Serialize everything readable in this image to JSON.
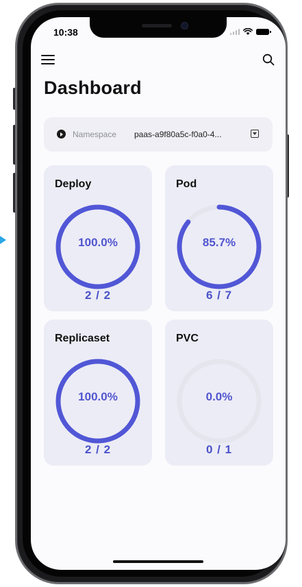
{
  "status_bar": {
    "time": "10:38"
  },
  "header": {
    "title": "Dashboard"
  },
  "namespace": {
    "label": "Namespace",
    "value": "paas-a9f80a5c-f0a0-4..."
  },
  "cards": [
    {
      "title": "Deploy",
      "percent_label": "100.0%",
      "count": "2 / 2",
      "ratio": 1.0
    },
    {
      "title": "Pod",
      "percent_label": "85.7%",
      "count": "6 / 7",
      "ratio": 0.857
    },
    {
      "title": "Replicaset",
      "percent_label": "100.0%",
      "count": "2 / 2",
      "ratio": 1.0
    },
    {
      "title": "PVC",
      "percent_label": "0.0%",
      "count": "0 / 1",
      "ratio": 0.0
    }
  ],
  "colors": {
    "accent": "#5157d6",
    "track": "#e5e5ee",
    "card_bg": "#ececf6"
  },
  "icons": {
    "menu": "hamburger-menu-icon",
    "search": "search-icon",
    "namespace_marker": "play-circle-icon",
    "dropdown": "dropdown-square-icon"
  }
}
